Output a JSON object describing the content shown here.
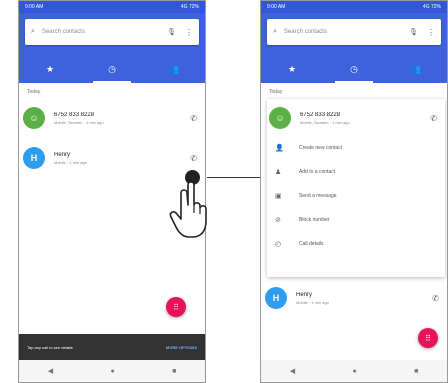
{
  "phone_left": {
    "status": {
      "left": "9:00 AM",
      "right": "4G 72%"
    },
    "search": {
      "placeholder": "Search contacts",
      "icon": "search-icon",
      "mic_icon": "mic-icon",
      "more_icon": "more-vertical-icon"
    },
    "tabs": [
      {
        "icon": "star-icon",
        "glyph": "★"
      },
      {
        "icon": "recents-icon",
        "glyph": "◷"
      },
      {
        "icon": "contacts-icon",
        "glyph": "👥"
      }
    ],
    "section_label": "Today",
    "calls": [
      {
        "avatar": "☺",
        "name": "6752 833 8228",
        "detail": "Mobile, Sweden · 1 min ago",
        "icon": "phone-icon",
        "glyph": "✆"
      },
      {
        "avatar": "H",
        "name": "Henry",
        "detail": "Mobile · 1 min ago",
        "icon": "phone-icon",
        "glyph": "✆"
      }
    ],
    "fab_icon": "dialpad-icon",
    "fab_glyph": "⠿",
    "snackbar": {
      "text": "Tap any call to see details",
      "action": "MORE OPTIONS"
    },
    "nav": [
      {
        "icon": "back-icon",
        "glyph": "◀"
      },
      {
        "icon": "home-icon",
        "glyph": "●"
      },
      {
        "icon": "recents-app-icon",
        "glyph": "■"
      }
    ]
  },
  "phone_right": {
    "status": {
      "left": "9:00 AM",
      "right": "4G 72%"
    },
    "search": {
      "placeholder": "Search contacts",
      "icon": "search-icon",
      "mic_icon": "mic-icon",
      "more_icon": "more-vertical-icon"
    },
    "tabs": [
      {
        "icon": "star-icon",
        "glyph": "★"
      },
      {
        "icon": "recents-icon",
        "glyph": "◷"
      },
      {
        "icon": "contacts-icon",
        "glyph": "👥"
      }
    ],
    "section_label": "Today",
    "expanded_call": {
      "avatar": "☺",
      "name": "6752 833 8228",
      "detail": "Mobile, Sweden · 1 min ago",
      "icon": "phone-icon",
      "glyph": "✆"
    },
    "menu": [
      {
        "icon": "person-add-icon",
        "glyph": "👤",
        "label": "Create new contact"
      },
      {
        "icon": "person-icon",
        "glyph": "♟",
        "label": "Add to a contact"
      },
      {
        "icon": "message-icon",
        "glyph": "▣",
        "label": "Send a message"
      },
      {
        "icon": "block-icon",
        "glyph": "⊘",
        "label": "Block number"
      },
      {
        "icon": "history-icon",
        "glyph": "◴",
        "label": "Call details"
      }
    ],
    "second_call": {
      "avatar": "H",
      "name": "Henry",
      "detail": "Mobile · 1 min ago",
      "icon": "phone-icon",
      "glyph": "✆"
    },
    "fab_icon": "dialpad-icon",
    "fab_glyph": "⠿",
    "nav": [
      {
        "icon": "back-icon",
        "glyph": "◀"
      },
      {
        "icon": "home-icon",
        "glyph": "●"
      },
      {
        "icon": "recents-app-icon",
        "glyph": "■"
      }
    ]
  },
  "colors": {
    "accent": "#3d62dc",
    "status_bar": "#3157d8",
    "fab": "#e8125a",
    "avatar_green": "#5caf45",
    "avatar_blue": "#2e9df0"
  }
}
